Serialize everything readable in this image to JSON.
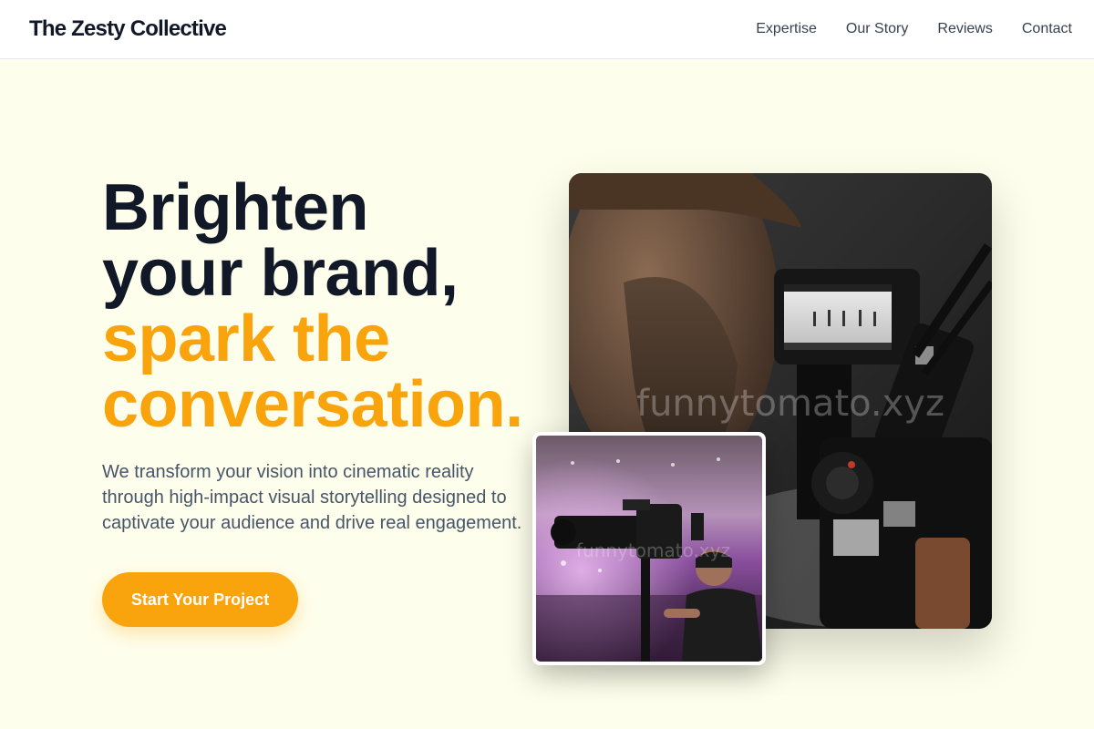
{
  "brand": {
    "name": "The Zesty Collective"
  },
  "nav": {
    "links": [
      "Expertise",
      "Our Story",
      "Reviews",
      "Contact"
    ]
  },
  "hero": {
    "title_lines_dark": [
      "Brighten",
      "your brand,"
    ],
    "title_lines_accent": [
      "spark the",
      "conversation."
    ],
    "description": "We transform your vision into cinematic reality through high-impact visual storytelling designed to captivate your audience and drive real engagement.",
    "cta_label": "Start Your Project"
  },
  "images": {
    "main_watermark": "funnytomato.xyz",
    "inset_watermark": "funnytomato.xyz",
    "main_icon": "videographer-with-camera-photo",
    "inset_icon": "camera-operator-at-event-photo"
  },
  "colors": {
    "page_bg": "#fefeec",
    "accent": "#f9a40c",
    "heading": "#111827",
    "body_text": "#475569",
    "nav_text": "#374151"
  }
}
